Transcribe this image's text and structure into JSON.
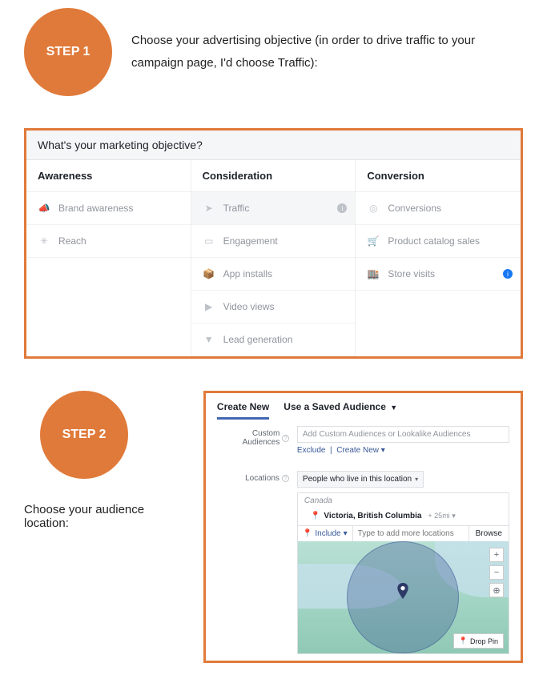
{
  "step1": {
    "badge": "STEP 1",
    "text": "Choose your advertising objective (in order to drive traffic to your campaign page, I'd choose Traffic):"
  },
  "objectives": {
    "header": "What's your marketing objective?",
    "columns": [
      "Awareness",
      "Consideration",
      "Conversion"
    ],
    "awareness": [
      {
        "label": "Brand awareness"
      },
      {
        "label": "Reach"
      }
    ],
    "consideration": [
      {
        "label": "Traffic",
        "selected": true
      },
      {
        "label": "Engagement"
      },
      {
        "label": "App installs"
      },
      {
        "label": "Video views"
      },
      {
        "label": "Lead generation"
      }
    ],
    "conversion": [
      {
        "label": "Conversions"
      },
      {
        "label": "Product catalog sales"
      },
      {
        "label": "Store visits",
        "info_blue": true
      }
    ]
  },
  "step2": {
    "badge": "STEP 2",
    "caption": "Choose your audience location:"
  },
  "audience": {
    "tabs": {
      "create_new": "Create New",
      "saved": "Use a Saved Audience"
    },
    "custom_label": "Custom Audiences",
    "custom_placeholder": "Add Custom Audiences or Lookalike Audiences",
    "exclude": "Exclude",
    "create_new_link": "Create New",
    "locations_label": "Locations",
    "people_dropdown": "People who live in this location",
    "country": "Canada",
    "city": "Victoria, British Columbia",
    "radius": "+ 25mi",
    "include": "Include",
    "search_placeholder": "Type to add more locations",
    "browse": "Browse",
    "drop_pin": "Drop Pin",
    "zoom_in": "+",
    "zoom_out": "−",
    "compass": "⊕"
  }
}
